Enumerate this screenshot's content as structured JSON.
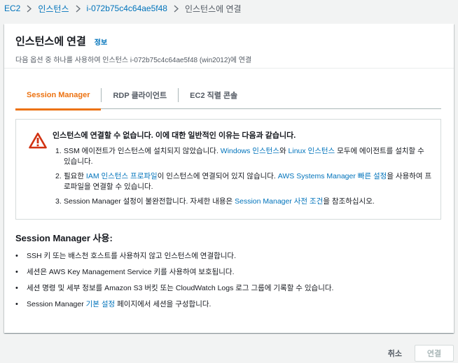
{
  "breadcrumb": {
    "items": [
      "EC2",
      "인스턴스",
      "i-072b75c4c64ae5f48"
    ],
    "current": "인스턴스에 연결"
  },
  "panel": {
    "title": "인스턴스에 연결",
    "info_link": "정보",
    "description": "다음 옵션 중 하나를 사용하여 인스턴스 i-072b75c4c64ae5f48 (win2012)에 연결"
  },
  "tabs": [
    {
      "label": "Session Manager",
      "active": true
    },
    {
      "label": "RDP 클라이언트",
      "active": false
    },
    {
      "label": "EC2 직렬 콘솔",
      "active": false
    }
  ],
  "alert": {
    "icon": "warning-triangle-icon",
    "title": "인스턴스에 연결할 수 없습니다. 이에 대한 일반적인 이유는 다음과 같습니다.",
    "items": [
      {
        "num": "1.",
        "before": "SSM 에이전트가 인스턴스에 설치되지 않았습니다. ",
        "link1": "Windows 인스턴스",
        "mid": "와 ",
        "link2": "Linux 인스턴스",
        "after": " 모두에 에이전트를 설치할 수 있습니다."
      },
      {
        "num": "2.",
        "before": "필요한 ",
        "link1": "IAM 인스턴스 프로파일",
        "mid": "이 인스턴스에 연결되어 있지 않습니다. ",
        "link2": "AWS Systems Manager 빠른 설정",
        "after": "을 사용하여 프로파일을 연결할 수 있습니다."
      },
      {
        "num": "3.",
        "before": "Session Manager 설정이 불완전합니다. 자세한 내용은 ",
        "link1": "Session Manager 사전 조건",
        "after": "을 참조하십시오."
      }
    ]
  },
  "usage": {
    "title": "Session Manager 사용:",
    "items": [
      "SSH 키 또는 배스천 호스트를 사용하지 않고 인스턴스에 연결합니다.",
      "세션은 AWS Key Management Service 키를 사용하여 보호됩니다.",
      "세션 명령 및 세부 정보를 Amazon S3 버킷 또는 CloudWatch Logs 로그 그룹에 기록할 수 있습니다."
    ],
    "last_before": "Session Manager ",
    "last_link": "기본 설정",
    "last_after": " 페이지에서 세션을 구성합니다."
  },
  "buttons": {
    "cancel": "취소",
    "connect": "연결"
  }
}
